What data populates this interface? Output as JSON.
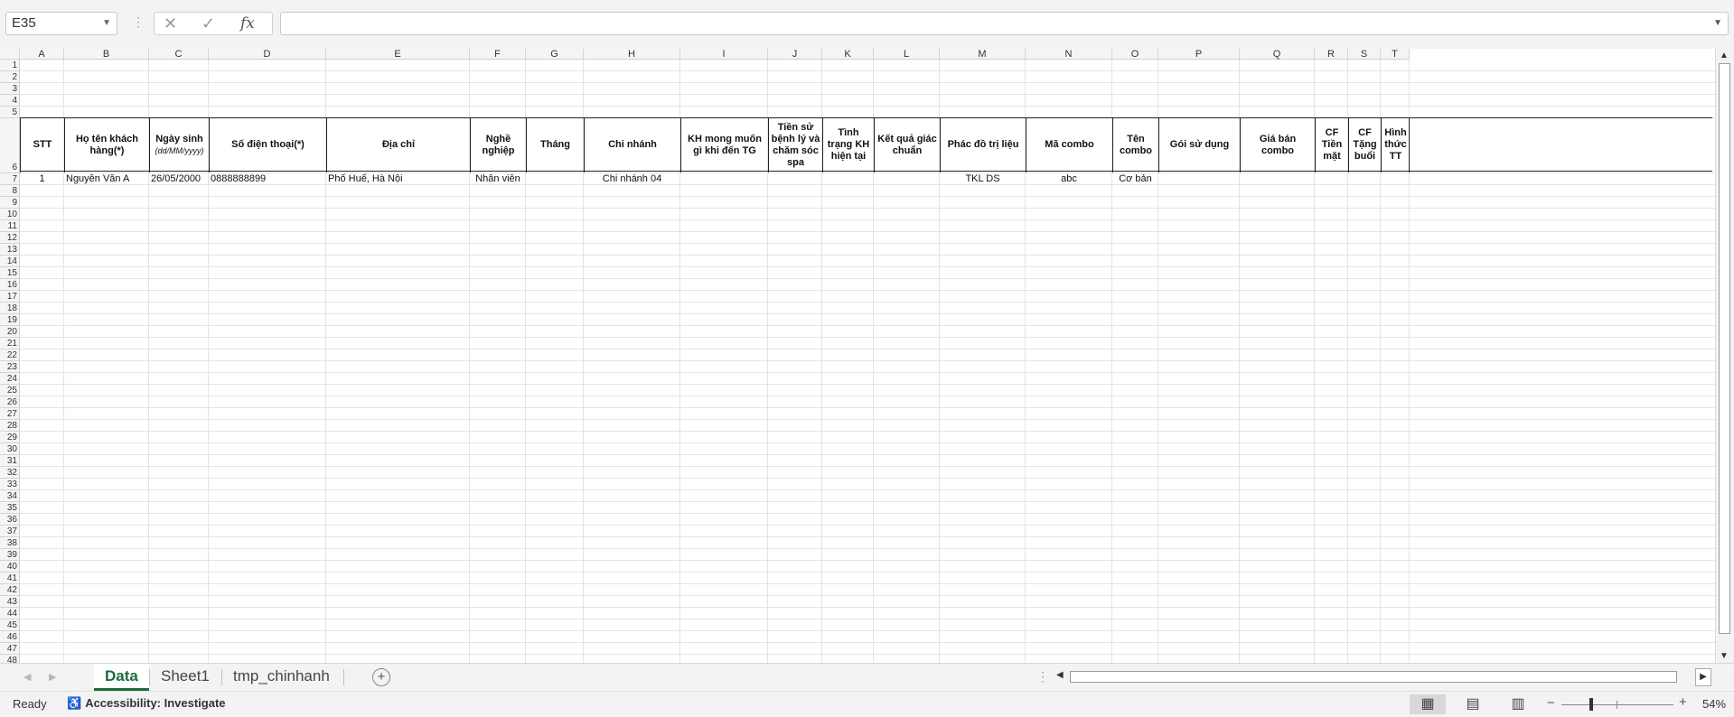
{
  "formula_bar": {
    "name_box": "E35",
    "cancel_icon": "✕",
    "enter_icon": "✓",
    "fx_label": "fx",
    "formula_value": ""
  },
  "columns": [
    "A",
    "B",
    "C",
    "D",
    "E",
    "F",
    "G",
    "H",
    "I",
    "J",
    "K",
    "L",
    "M",
    "N",
    "O",
    "P",
    "Q",
    "R",
    "S",
    "T"
  ],
  "rows": [
    "1",
    "2",
    "3",
    "4",
    "5",
    "6",
    "7",
    "8",
    "9",
    "10",
    "11",
    "12",
    "13",
    "14",
    "15",
    "16",
    "17",
    "18",
    "19",
    "20",
    "21",
    "22",
    "23",
    "24",
    "25",
    "26",
    "27",
    "28",
    "29",
    "30",
    "31",
    "32",
    "33",
    "34",
    "35",
    "36",
    "37",
    "38",
    "39",
    "40",
    "41",
    "42",
    "43",
    "44",
    "45",
    "46",
    "47",
    "48"
  ],
  "table_headers": [
    {
      "text": "STT"
    },
    {
      "text": "Họ tên khách hàng(*)"
    },
    {
      "text": "Ngày sinh",
      "sub": "(dd/MM/yyyy)"
    },
    {
      "text": "Số điện thoại(*)"
    },
    {
      "text": "Địa chỉ"
    },
    {
      "text": "Nghề nghiệp"
    },
    {
      "text": "Tháng"
    },
    {
      "text": "Chi nhánh"
    },
    {
      "text": "KH mong muốn gì khi đến TG"
    },
    {
      "text": "Tiền sử bệnh lý và chăm sóc spa"
    },
    {
      "text": "Tình trạng KH hiện tại"
    },
    {
      "text": "Kết quả giác chuẩn"
    },
    {
      "text": "Phác đồ trị liệu"
    },
    {
      "text": "Mã combo"
    },
    {
      "text": "Tên combo"
    },
    {
      "text": "Gói sử dụng"
    },
    {
      "text": "Giá bán combo"
    },
    {
      "text": "CF Tiền mặt"
    },
    {
      "text": "CF Tặng buổi"
    },
    {
      "text": "Hình thức TT"
    }
  ],
  "data_row": [
    "1",
    "Nguyễn Văn A",
    "26/05/2000",
    "0888888899",
    "Phố Huế, Hà Nội",
    "Nhân viên",
    "",
    "Chi nhánh 04",
    "",
    "",
    "",
    "",
    "TKL DS",
    "abc",
    "Cơ bản",
    "",
    "",
    "",
    "",
    ""
  ],
  "sheet_tabs": [
    {
      "label": "Data",
      "active": true
    },
    {
      "label": "Sheet1",
      "active": false
    },
    {
      "label": "tmp_chinhanh",
      "active": false
    }
  ],
  "status_bar": {
    "ready": "Ready",
    "accessibility": "Accessibility: Investigate",
    "zoom": "54%"
  },
  "icons": {
    "normal_view": "grid-icon",
    "page_layout": "page-layout-icon",
    "page_break": "page-break-icon"
  },
  "accent_color": "#1e6b3c"
}
